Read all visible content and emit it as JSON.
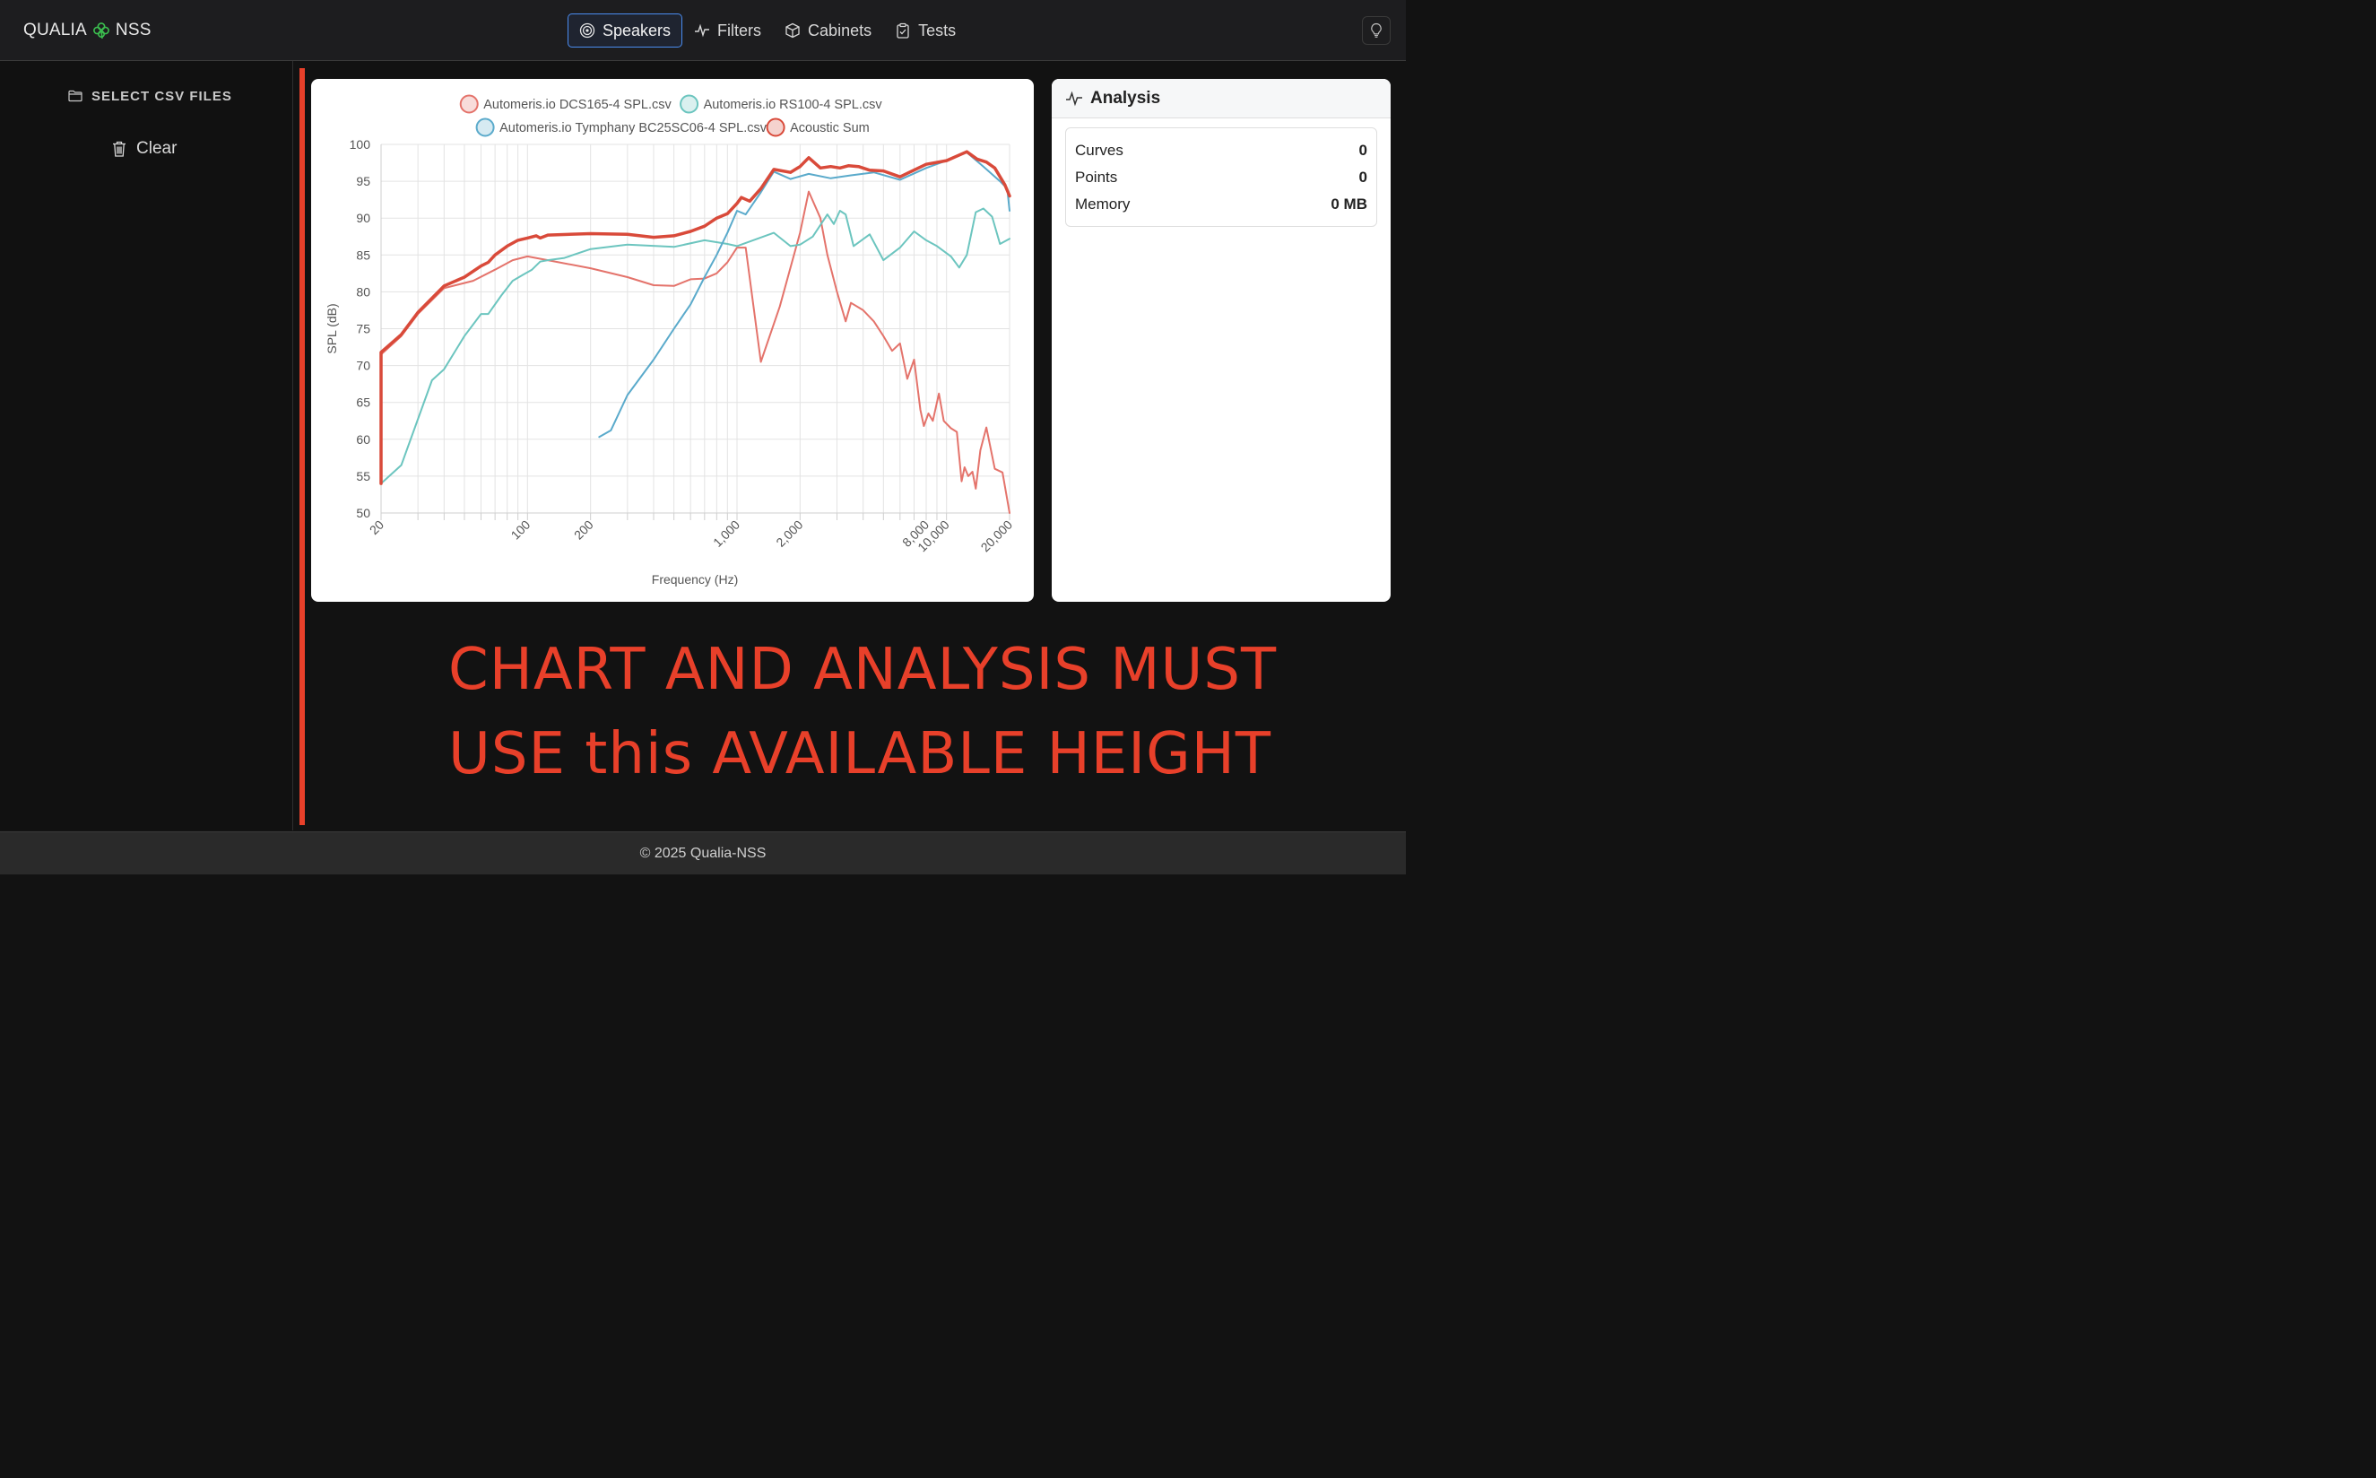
{
  "brand": {
    "left": "QUALIA",
    "right": "NSS"
  },
  "nav": {
    "tabs": [
      {
        "label": "Speakers",
        "active": true
      },
      {
        "label": "Filters",
        "active": false
      },
      {
        "label": "Cabinets",
        "active": false
      },
      {
        "label": "Tests",
        "active": false
      }
    ]
  },
  "sidebar": {
    "select_label": "SELECT CSV FILES",
    "clear_label": "Clear"
  },
  "analysis": {
    "title": "Analysis",
    "stats": [
      {
        "label": "Curves",
        "value": "0"
      },
      {
        "label": "Points",
        "value": "0"
      },
      {
        "label": "Memory",
        "value": "0 MB"
      }
    ]
  },
  "annotation": {
    "line1": "CHART AND ANALYSIS MUST",
    "line2": "USE this AVAILABLE HEIGHT"
  },
  "footer": {
    "text": "© 2025 Qualia-NSS"
  },
  "colors": {
    "accent_red": "#e8402a",
    "series_red": "#e4736b",
    "series_teal": "#6cc5bf",
    "series_blue": "#5aaacb",
    "sum_red": "#d94a3a"
  },
  "chart_data": {
    "type": "line",
    "xscale": "log",
    "xlabel": "Frequency (Hz)",
    "ylabel": "SPL (dB)",
    "xlim": [
      20,
      20000
    ],
    "ylim": [
      50,
      100
    ],
    "xticks": [
      "20",
      "100",
      "200",
      "1,000",
      "2,000",
      "8,000",
      "10,000",
      "20,000"
    ],
    "xtick_values": [
      20,
      100,
      200,
      1000,
      2000,
      8000,
      10000,
      20000
    ],
    "yticks": [
      50,
      55,
      60,
      65,
      70,
      75,
      80,
      85,
      90,
      95,
      100
    ],
    "grid": true,
    "legend_position": "top",
    "series": [
      {
        "name": "Automeris.io DCS165-4 SPL.csv",
        "color": "#e4736b",
        "width": 2,
        "points": [
          [
            20,
            54
          ],
          [
            20,
            71.5
          ],
          [
            25,
            74
          ],
          [
            30,
            77
          ],
          [
            40,
            80.5
          ],
          [
            55,
            81.5
          ],
          [
            70,
            83
          ],
          [
            85,
            84.3
          ],
          [
            100,
            84.8
          ],
          [
            130,
            84.2
          ],
          [
            200,
            83.2
          ],
          [
            300,
            82
          ],
          [
            400,
            80.9
          ],
          [
            500,
            80.8
          ],
          [
            600,
            81.7
          ],
          [
            700,
            81.8
          ],
          [
            800,
            82.5
          ],
          [
            900,
            84
          ],
          [
            1000,
            86
          ],
          [
            1100,
            86
          ],
          [
            1300,
            70.5
          ],
          [
            1600,
            78
          ],
          [
            2000,
            88
          ],
          [
            2200,
            93.6
          ],
          [
            2500,
            90
          ],
          [
            2700,
            85
          ],
          [
            3000,
            80
          ],
          [
            3300,
            76
          ],
          [
            3500,
            78.5
          ],
          [
            4000,
            77.5
          ],
          [
            4500,
            76
          ],
          [
            5000,
            74
          ],
          [
            5500,
            72
          ],
          [
            6000,
            73
          ],
          [
            6500,
            68.2
          ],
          [
            7000,
            70.8
          ],
          [
            7500,
            64
          ],
          [
            7800,
            61.8
          ],
          [
            8200,
            63.5
          ],
          [
            8600,
            62.5
          ],
          [
            9200,
            66.2
          ],
          [
            9700,
            62.5
          ],
          [
            10500,
            61.5
          ],
          [
            11200,
            61
          ],
          [
            11800,
            54.3
          ],
          [
            12200,
            56.2
          ],
          [
            12700,
            55
          ],
          [
            13300,
            55.6
          ],
          [
            13800,
            53.3
          ],
          [
            14500,
            58.5
          ],
          [
            15500,
            61.6
          ],
          [
            17000,
            56
          ],
          [
            18500,
            55.5
          ],
          [
            20000,
            50
          ]
        ]
      },
      {
        "name": "Automeris.io RS100-4 SPL.csv",
        "color": "#6cc5bf",
        "width": 2,
        "points": [
          [
            20,
            54
          ],
          [
            25,
            56.5
          ],
          [
            35,
            68
          ],
          [
            40,
            69.5
          ],
          [
            50,
            74
          ],
          [
            60,
            77
          ],
          [
            65,
            77
          ],
          [
            75,
            79.5
          ],
          [
            85,
            81.5
          ],
          [
            95,
            82.3
          ],
          [
            105,
            83
          ],
          [
            115,
            84.1
          ],
          [
            125,
            84.3
          ],
          [
            150,
            84.6
          ],
          [
            200,
            85.8
          ],
          [
            300,
            86.4
          ],
          [
            500,
            86.1
          ],
          [
            700,
            87
          ],
          [
            900,
            86.5
          ],
          [
            1000,
            86.2
          ],
          [
            1500,
            88
          ],
          [
            1800,
            86.2
          ],
          [
            2000,
            86.4
          ],
          [
            2300,
            87.5
          ],
          [
            2700,
            90.5
          ],
          [
            2900,
            89.2
          ],
          [
            3100,
            91
          ],
          [
            3300,
            90.5
          ],
          [
            3600,
            86.2
          ],
          [
            4300,
            87.8
          ],
          [
            5000,
            84.3
          ],
          [
            6000,
            86
          ],
          [
            7000,
            88.2
          ],
          [
            8000,
            87
          ],
          [
            9000,
            86.2
          ],
          [
            10500,
            84.8
          ],
          [
            11500,
            83.3
          ],
          [
            12500,
            85
          ],
          [
            13800,
            90.8
          ],
          [
            15000,
            91.3
          ],
          [
            16500,
            90.2
          ],
          [
            18000,
            86.5
          ],
          [
            20000,
            87.2
          ]
        ]
      },
      {
        "name": "Automeris.io Tymphany BC25SC06-4 SPL.csv",
        "color": "#5aaacb",
        "width": 2,
        "points": [
          [
            220,
            60.3
          ],
          [
            250,
            61.2
          ],
          [
            300,
            66
          ],
          [
            400,
            70.8
          ],
          [
            500,
            75
          ],
          [
            600,
            78.3
          ],
          [
            700,
            82
          ],
          [
            800,
            85
          ],
          [
            900,
            88
          ],
          [
            1000,
            91
          ],
          [
            1100,
            90.5
          ],
          [
            1300,
            93.5
          ],
          [
            1500,
            96.3
          ],
          [
            1800,
            95.3
          ],
          [
            2200,
            96
          ],
          [
            2800,
            95.4
          ],
          [
            3500,
            95.8
          ],
          [
            4500,
            96.2
          ],
          [
            6000,
            95.2
          ],
          [
            8000,
            96.8
          ],
          [
            10000,
            97.8
          ],
          [
            12500,
            98.9
          ],
          [
            15000,
            97
          ],
          [
            18000,
            95
          ],
          [
            19500,
            94
          ],
          [
            20000,
            91
          ]
        ]
      },
      {
        "name": "Acoustic Sum",
        "color": "#d94a3a",
        "width": 3.5,
        "points": [
          [
            20,
            54
          ],
          [
            20,
            71.8
          ],
          [
            25,
            74.2
          ],
          [
            30,
            77.2
          ],
          [
            40,
            80.8
          ],
          [
            50,
            82
          ],
          [
            60,
            83.5
          ],
          [
            65,
            84
          ],
          [
            70,
            85
          ],
          [
            80,
            86.2
          ],
          [
            90,
            87
          ],
          [
            100,
            87.3
          ],
          [
            110,
            87.6
          ],
          [
            115,
            87.3
          ],
          [
            125,
            87.7
          ],
          [
            200,
            87.9
          ],
          [
            300,
            87.8
          ],
          [
            400,
            87.4
          ],
          [
            500,
            87.6
          ],
          [
            600,
            88.2
          ],
          [
            700,
            88.9
          ],
          [
            800,
            90
          ],
          [
            900,
            90.6
          ],
          [
            1000,
            92
          ],
          [
            1050,
            92.8
          ],
          [
            1150,
            92.3
          ],
          [
            1300,
            94
          ],
          [
            1500,
            96.6
          ],
          [
            1800,
            96.2
          ],
          [
            2000,
            97
          ],
          [
            2200,
            98.2
          ],
          [
            2500,
            96.8
          ],
          [
            2800,
            97
          ],
          [
            3100,
            96.8
          ],
          [
            3400,
            97.1
          ],
          [
            3800,
            97
          ],
          [
            4300,
            96.5
          ],
          [
            5000,
            96.4
          ],
          [
            6000,
            95.6
          ],
          [
            8000,
            97.3
          ],
          [
            10000,
            97.8
          ],
          [
            12500,
            99
          ],
          [
            14000,
            98
          ],
          [
            15500,
            97.6
          ],
          [
            17000,
            96.8
          ],
          [
            19000,
            94.5
          ],
          [
            20000,
            93
          ]
        ]
      }
    ]
  }
}
